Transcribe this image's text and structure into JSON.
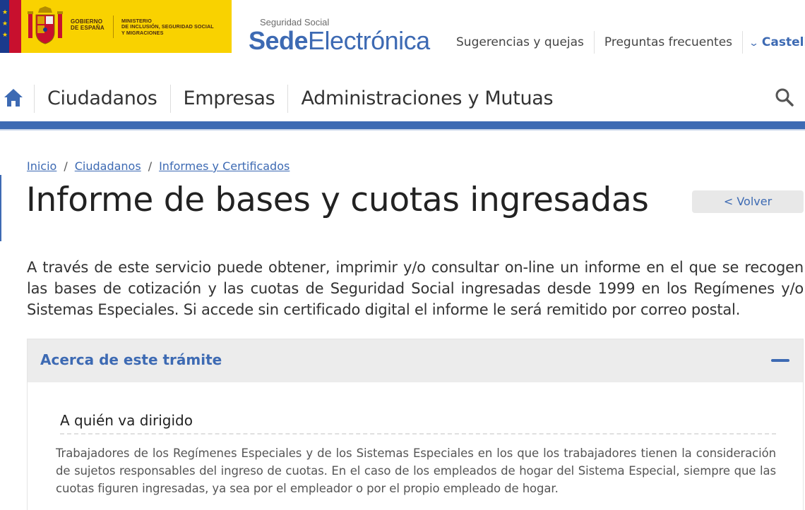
{
  "header": {
    "gov_text": [
      "GOBIERNO",
      "DE ESPAÑA"
    ],
    "ministry_text": [
      "MINISTERIO",
      "DE INCLUSIÓN, SEGURIDAD SOCIAL",
      "Y MIGRACIONES"
    ],
    "sede_small": "Seguridad Social",
    "sede_bold": "Sede",
    "sede_light": "Electrónica",
    "links": [
      "Sugerencias y quejas",
      "Preguntas frecuentes"
    ],
    "language": "Castellan",
    "colors": {
      "brand_blue": "#3d6ab3",
      "gov_yellow": "#f9d200"
    }
  },
  "nav": {
    "items": [
      "Ciudadanos",
      "Empresas",
      "Administraciones y Mutuas"
    ],
    "home_icon": "home-icon",
    "search_icon": "search-icon"
  },
  "breadcrumb": [
    "Inicio",
    "Ciudadanos",
    "Informes y Certificados"
  ],
  "page": {
    "title": "Informe de bases y cuotas ingresadas",
    "back_label": "< Volver",
    "intro": "A través de este servicio puede obtener, imprimir y/o consultar on-line un informe en el que se recogen las bases de cotización y las cuotas de Seguridad Social ingresadas desde 1999 en los Regímenes y/o Sistemas Especiales. Si accede sin certificado digital el informe le será remitido por correo postal."
  },
  "accordion": {
    "title": "Acerca de este trámite",
    "section_title": "A quién va dirigido",
    "section_text": "Trabajadores de los Regímenes Especiales y de los Sistemas Especiales en los que los trabajadores tienen la consideración de sujetos responsables del ingreso de cuotas. En el caso de los empleados de hogar del Sistema Especial, siempre que las cuotas figuren ingresadas, ya sea por el empleador o por el propio empleado de hogar."
  }
}
